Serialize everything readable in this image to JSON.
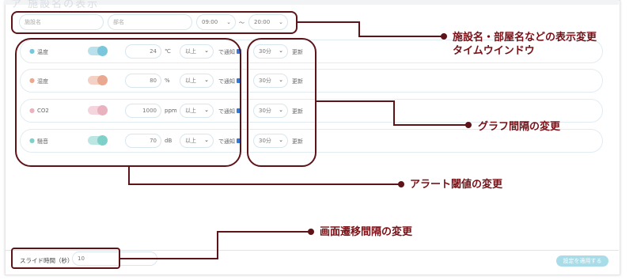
{
  "header_faded": "ア 施設名の表示",
  "facility_name_placeholder": "施設名",
  "room_name_placeholder": "部名",
  "time_start": "09:00",
  "time_tilde": "〜",
  "time_end": "20:00",
  "rows": [
    {
      "name": "温度",
      "value": "24",
      "unit": "℃",
      "cond": "以上",
      "notify": "で通知",
      "interval": "30分",
      "update": "更新",
      "color": "#7ac7dc",
      "icon": "thermometer-icon"
    },
    {
      "name": "湿度",
      "value": "80",
      "unit": "%",
      "cond": "以上",
      "notify": "で通知",
      "interval": "30分",
      "update": "更新",
      "color": "#e9a890",
      "icon": "droplet-icon"
    },
    {
      "name": "CO2",
      "value": "1000",
      "unit": "ppm",
      "cond": "以上",
      "notify": "で通知",
      "interval": "30分",
      "update": "更新",
      "color": "#eab1bf",
      "icon": "co2-icon"
    },
    {
      "name": "騒音",
      "value": "70",
      "unit": "dB",
      "cond": "以上",
      "notify": "で通知",
      "interval": "30分",
      "update": "更新",
      "color": "#7fd0c8",
      "icon": "speaker-icon"
    }
  ],
  "slide_label": "スライド時間（秒）",
  "slide_value": "10",
  "apply_label": "設定を適用する",
  "annotations": {
    "a1_line1": "施設名・部屋名などの表示変更",
    "a1_line2": "タイムウインドウ",
    "a2": "グラフ間隔の変更",
    "a3": "アラート閾値の変更",
    "a4": "画面遷移間隔の変更"
  },
  "colors": {
    "annotation": "#5e1318",
    "apply": "#a7dce8",
    "checkbox": "#3a76d8"
  }
}
